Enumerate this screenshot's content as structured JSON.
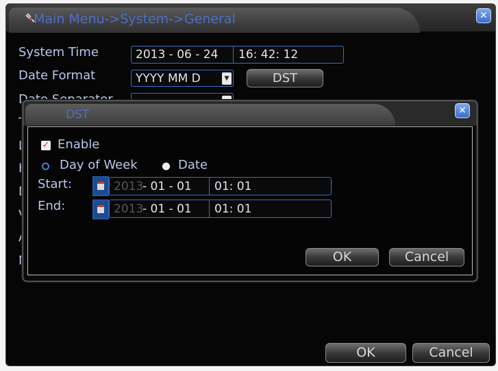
{
  "window": {
    "title": "Main Menu->System->General",
    "close_icon": "close-icon"
  },
  "general": {
    "system_time_label": "System Time",
    "system_date": "2013 - 06 - 24",
    "system_clock": "16: 42: 12",
    "date_format_label": "Date Format",
    "date_format_value": "YYYY MM D",
    "dst_button": "DST",
    "date_separator_label": "Date Separator",
    "hidden_labels": [
      "T",
      "L",
      "H",
      "D",
      "V",
      "A",
      "N"
    ]
  },
  "dst": {
    "title": "DST",
    "enable_label": "Enable",
    "enable_checked": true,
    "mode_day_of_week": "Day of Week",
    "mode_date": "Date",
    "selected_mode": "Date",
    "start_label": "Start:",
    "start_year": "2013",
    "start_md": "- 01 - 01",
    "start_time": "01: 01",
    "end_label": "End:",
    "end_year": "2013",
    "end_md": "- 01 - 01",
    "end_time": "01: 01",
    "ok": "OK",
    "cancel": "Cancel"
  },
  "footer": {
    "ok": "OK",
    "cancel": "Cancel"
  },
  "colors": {
    "accent_blue": "#3a6fc4",
    "label_blue": "#b8c7ea",
    "title_blue": "#4d6fc9"
  }
}
